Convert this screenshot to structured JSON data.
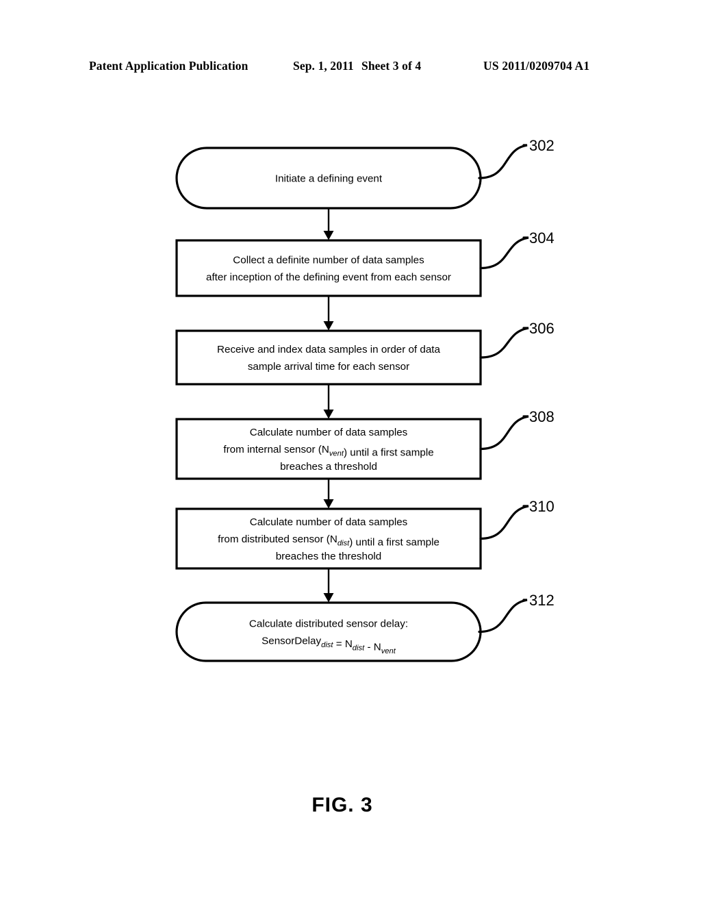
{
  "header": {
    "publication": "Patent Application Publication",
    "date": "Sep. 1, 2011",
    "sheet": "Sheet 3 of 4",
    "patent_number": "US 2011/0209704 A1"
  },
  "figure": {
    "caption": "FIG. 3",
    "type": "flowchart",
    "nodes": [
      {
        "ref": "302",
        "shape": "stadium",
        "lines": [
          [
            {
              "t": "Initiate a defining event"
            }
          ]
        ]
      },
      {
        "ref": "304",
        "shape": "rect",
        "lines": [
          [
            {
              "t": "Collect a definite number of data samples"
            }
          ],
          [
            {
              "t": "after inception of the defining event from each sensor"
            }
          ]
        ]
      },
      {
        "ref": "306",
        "shape": "rect",
        "lines": [
          [
            {
              "t": "Receive and index data samples in order of data"
            }
          ],
          [
            {
              "t": "sample arrival time for each sensor"
            }
          ]
        ]
      },
      {
        "ref": "308",
        "shape": "rect",
        "lines": [
          [
            {
              "t": "Calculate number of data samples"
            }
          ],
          [
            {
              "t": "from internal sensor (N"
            },
            {
              "t": "vent",
              "sub": true
            },
            {
              "t": ") until a first sample"
            }
          ],
          [
            {
              "t": "breaches a threshold"
            }
          ]
        ]
      },
      {
        "ref": "310",
        "shape": "rect",
        "lines": [
          [
            {
              "t": "Calculate number of data samples"
            }
          ],
          [
            {
              "t": "from distributed sensor (N"
            },
            {
              "t": "dist",
              "sub": true
            },
            {
              "t": ") until a first sample"
            }
          ],
          [
            {
              "t": "breaches the threshold"
            }
          ]
        ]
      },
      {
        "ref": "312",
        "shape": "stadium",
        "lines": [
          [
            {
              "t": "Calculate distributed sensor delay:"
            }
          ],
          [
            {
              "t": "SensorDelay"
            },
            {
              "t": "dist",
              "sub": true
            },
            {
              "t": " = N"
            },
            {
              "t": "dist",
              "sub": true
            },
            {
              "t": " - N"
            },
            {
              "t": "vent",
              "sub": true
            }
          ]
        ]
      }
    ]
  }
}
